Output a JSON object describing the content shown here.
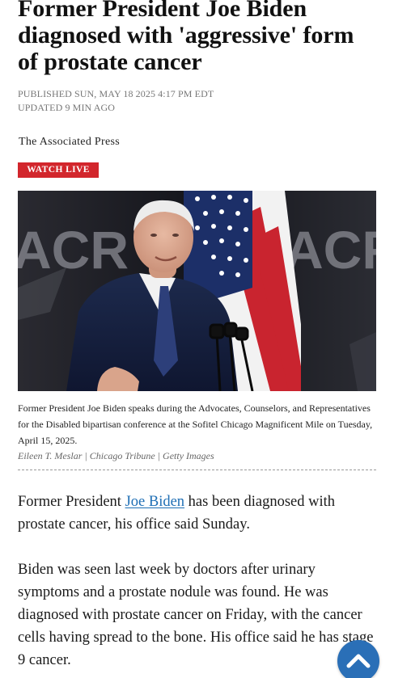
{
  "article": {
    "headline": "Former President Joe Biden diagnosed with 'aggressive' form of prostate cancer",
    "published": "PUBLISHED SUN, MAY 18 2025 4:17 PM EDT",
    "updated": "UPDATED 9 MIN AGO",
    "byline": "The Associated Press",
    "watch_live_label": "WATCH LIVE"
  },
  "photo": {
    "sign_left_text": "ACR",
    "sign_right_text": "ACF"
  },
  "caption": {
    "text": "Former President Joe Biden speaks during the Advocates, Counselors, and Representatives for the Disabled bipartisan conference at the Sofitel Chicago Magnificent Mile on Tuesday, April 15, 2025.",
    "credit": "Eileen T. Meslar | Chicago Tribune | Getty Images"
  },
  "body": {
    "p1_before": "Former President ",
    "p1_link": "Joe Biden",
    "p1_after": " has been diagnosed with prostate cancer, his office said Sunday.",
    "p2": "Biden was seen last week by doctors after urinary symptoms and a prostate nodule was found. He was diagnosed with prostate cancer on Friday, with the cancer cells having spread to the bone. His office said he has stage 9 cancer."
  },
  "colors": {
    "accent_red": "#d2262c",
    "link_blue": "#1f6fb5",
    "fab_blue": "#2a6fb7"
  },
  "icons": {
    "scroll_top": "chevron-up-icon"
  }
}
